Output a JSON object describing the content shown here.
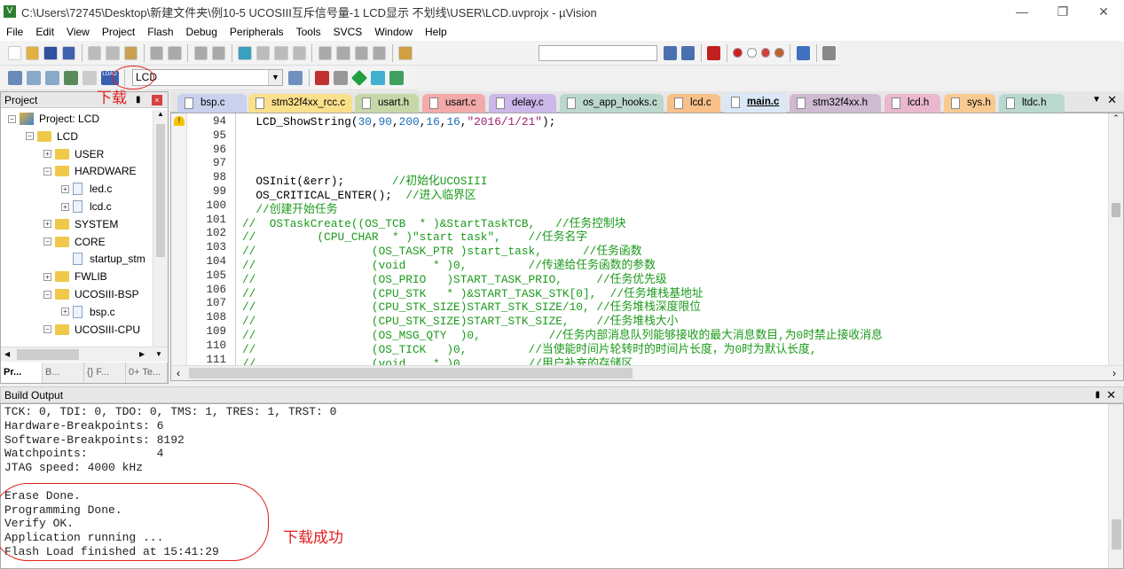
{
  "window": {
    "title": "C:\\Users\\72745\\Desktop\\新建文件夹\\例10-5 UCOSIII互斥信号量-1 LCD显示 不划线\\USER\\LCD.uvprojx - µVision",
    "app_icon": "keil-uvision-icon"
  },
  "menu": [
    "File",
    "Edit",
    "View",
    "Project",
    "Flash",
    "Debug",
    "Peripherals",
    "Tools",
    "SVCS",
    "Window",
    "Help"
  ],
  "toolbar2": {
    "load_label": "LOAD",
    "target": "LCD"
  },
  "project_panel": {
    "title": "Project",
    "annotation": "下载",
    "tree": [
      {
        "label": "Project: LCD",
        "level": 0,
        "type": "root",
        "state": "-"
      },
      {
        "label": "LCD",
        "level": 1,
        "type": "target",
        "state": "-"
      },
      {
        "label": "USER",
        "level": 2,
        "type": "folder",
        "state": "+"
      },
      {
        "label": "HARDWARE",
        "level": 2,
        "type": "folder",
        "state": "-"
      },
      {
        "label": "led.c",
        "level": 3,
        "type": "file",
        "state": "+"
      },
      {
        "label": "lcd.c",
        "level": 3,
        "type": "file",
        "state": "+"
      },
      {
        "label": "SYSTEM",
        "level": 2,
        "type": "folder",
        "state": "+"
      },
      {
        "label": "CORE",
        "level": 2,
        "type": "folder",
        "state": "-"
      },
      {
        "label": "startup_stm",
        "level": 3,
        "type": "file",
        "state": ""
      },
      {
        "label": "FWLIB",
        "level": 2,
        "type": "folder",
        "state": "+"
      },
      {
        "label": "UCOSIII-BSP",
        "level": 2,
        "type": "folder",
        "state": "-"
      },
      {
        "label": "bsp.c",
        "level": 3,
        "type": "file",
        "state": "+"
      },
      {
        "label": "UCOSIII-CPU",
        "level": 2,
        "type": "folder",
        "state": "-"
      }
    ],
    "bottom_tabs": [
      "Pr...",
      "B...",
      "{} F...",
      "0+ Te..."
    ]
  },
  "tabs": [
    {
      "label": "bsp.c",
      "color": "#c9d1ef"
    },
    {
      "label": "stm32f4xx_rcc.c",
      "color": "#fbe08c"
    },
    {
      "label": "usart.h",
      "color": "#c6d8a8"
    },
    {
      "label": "usart.c",
      "color": "#f3aaaa"
    },
    {
      "label": "delay.c",
      "color": "#cbb7e8"
    },
    {
      "label": "os_app_hooks.c",
      "color": "#bcd8cd"
    },
    {
      "label": "lcd.c",
      "color": "#f8c08a"
    },
    {
      "label": "main.c",
      "color": "#dae7f6",
      "active": true
    },
    {
      "label": "stm32f4xx.h",
      "color": "#cfbad2"
    },
    {
      "label": "lcd.h",
      "color": "#eab8ce"
    },
    {
      "label": "sys.h",
      "color": "#f8ca92"
    },
    {
      "label": "ltdc.h",
      "color": "#b9d9d0"
    }
  ],
  "editor": {
    "lines": [
      {
        "n": "94",
        "seg": [
          {
            "t": "  LCD_ShowString(",
            "c": "k"
          },
          {
            "t": "30",
            "c": "n"
          },
          {
            "t": ",",
            "c": "k"
          },
          {
            "t": "90",
            "c": "n"
          },
          {
            "t": ",",
            "c": "k"
          },
          {
            "t": "200",
            "c": "n"
          },
          {
            "t": ",",
            "c": "k"
          },
          {
            "t": "16",
            "c": "n"
          },
          {
            "t": ",",
            "c": "k"
          },
          {
            "t": "16",
            "c": "n"
          },
          {
            "t": ",",
            "c": "k"
          },
          {
            "t": "\"2016/1/21\"",
            "c": "s"
          },
          {
            "t": ");",
            "c": "k"
          }
        ]
      },
      {
        "n": "95",
        "seg": []
      },
      {
        "n": "96",
        "seg": []
      },
      {
        "n": "97",
        "seg": []
      },
      {
        "n": "98",
        "seg": [
          {
            "t": "  OSInit(&err);       ",
            "c": "k"
          },
          {
            "t": "//初始化UCOSIII",
            "c": "c"
          }
        ]
      },
      {
        "n": "99",
        "seg": [
          {
            "t": "  OS_CRITICAL_ENTER();  ",
            "c": "k"
          },
          {
            "t": "//进入临界区",
            "c": "c"
          }
        ]
      },
      {
        "n": "100",
        "seg": [
          {
            "t": "  //创建开始任务",
            "c": "c"
          }
        ]
      },
      {
        "n": "101",
        "seg": [
          {
            "t": "//  OSTaskCreate((OS_TCB  * )&StartTaskTCB,   //任务控制块",
            "c": "c"
          }
        ]
      },
      {
        "n": "102",
        "seg": [
          {
            "t": "//         (CPU_CHAR  * )\"start task\",    //任务名字",
            "c": "c"
          }
        ]
      },
      {
        "n": "103",
        "seg": [
          {
            "t": "//                 (OS_TASK_PTR )start_task,      //任务函数",
            "c": "c"
          }
        ]
      },
      {
        "n": "104",
        "seg": [
          {
            "t": "//                 (void    * )0,         //传递给任务函数的参数",
            "c": "c"
          }
        ]
      },
      {
        "n": "105",
        "seg": [
          {
            "t": "//                 (OS_PRIO   )START_TASK_PRIO,     //任务优先级",
            "c": "c"
          }
        ]
      },
      {
        "n": "106",
        "seg": [
          {
            "t": "//                 (CPU_STK   * )&START_TASK_STK[0],  //任务堆栈基地址",
            "c": "c"
          }
        ]
      },
      {
        "n": "107",
        "seg": [
          {
            "t": "//                 (CPU_STK_SIZE)START_STK_SIZE/10, //任务堆栈深度限位",
            "c": "c"
          }
        ]
      },
      {
        "n": "108",
        "seg": [
          {
            "t": "//                 (CPU_STK_SIZE)START_STK_SIZE,    //任务堆栈大小",
            "c": "c"
          }
        ]
      },
      {
        "n": "109",
        "seg": [
          {
            "t": "//                 (OS_MSG_QTY  )0,          //任务内部消息队列能够接收的最大消息数目,为0时禁止接收消息",
            "c": "c"
          }
        ]
      },
      {
        "n": "110",
        "seg": [
          {
            "t": "//                 (OS_TICK   )0,         //当使能时间片轮转时的时间片长度，为0时为默认长度,",
            "c": "c"
          }
        ]
      },
      {
        "n": "111",
        "seg": [
          {
            "t": "//                 (void    * )0,         //用户补充的存储区",
            "c": "c"
          }
        ]
      }
    ]
  },
  "output": {
    "title": "Build Output",
    "lines": [
      "TCK: 0, TDI: 0, TDO: 0, TMS: 1, TRES: 1, TRST: 0",
      "Hardware-Breakpoints: 6",
      "Software-Breakpoints: 8192",
      "Watchpoints:          4",
      "JTAG speed: 4000 kHz",
      "",
      "Erase Done.",
      "Programming Done.",
      "Verify OK.",
      "Application running ...",
      "Flash Load finished at 15:41:29"
    ],
    "annotation": "下载成功"
  },
  "annotation_color": "#e02020"
}
